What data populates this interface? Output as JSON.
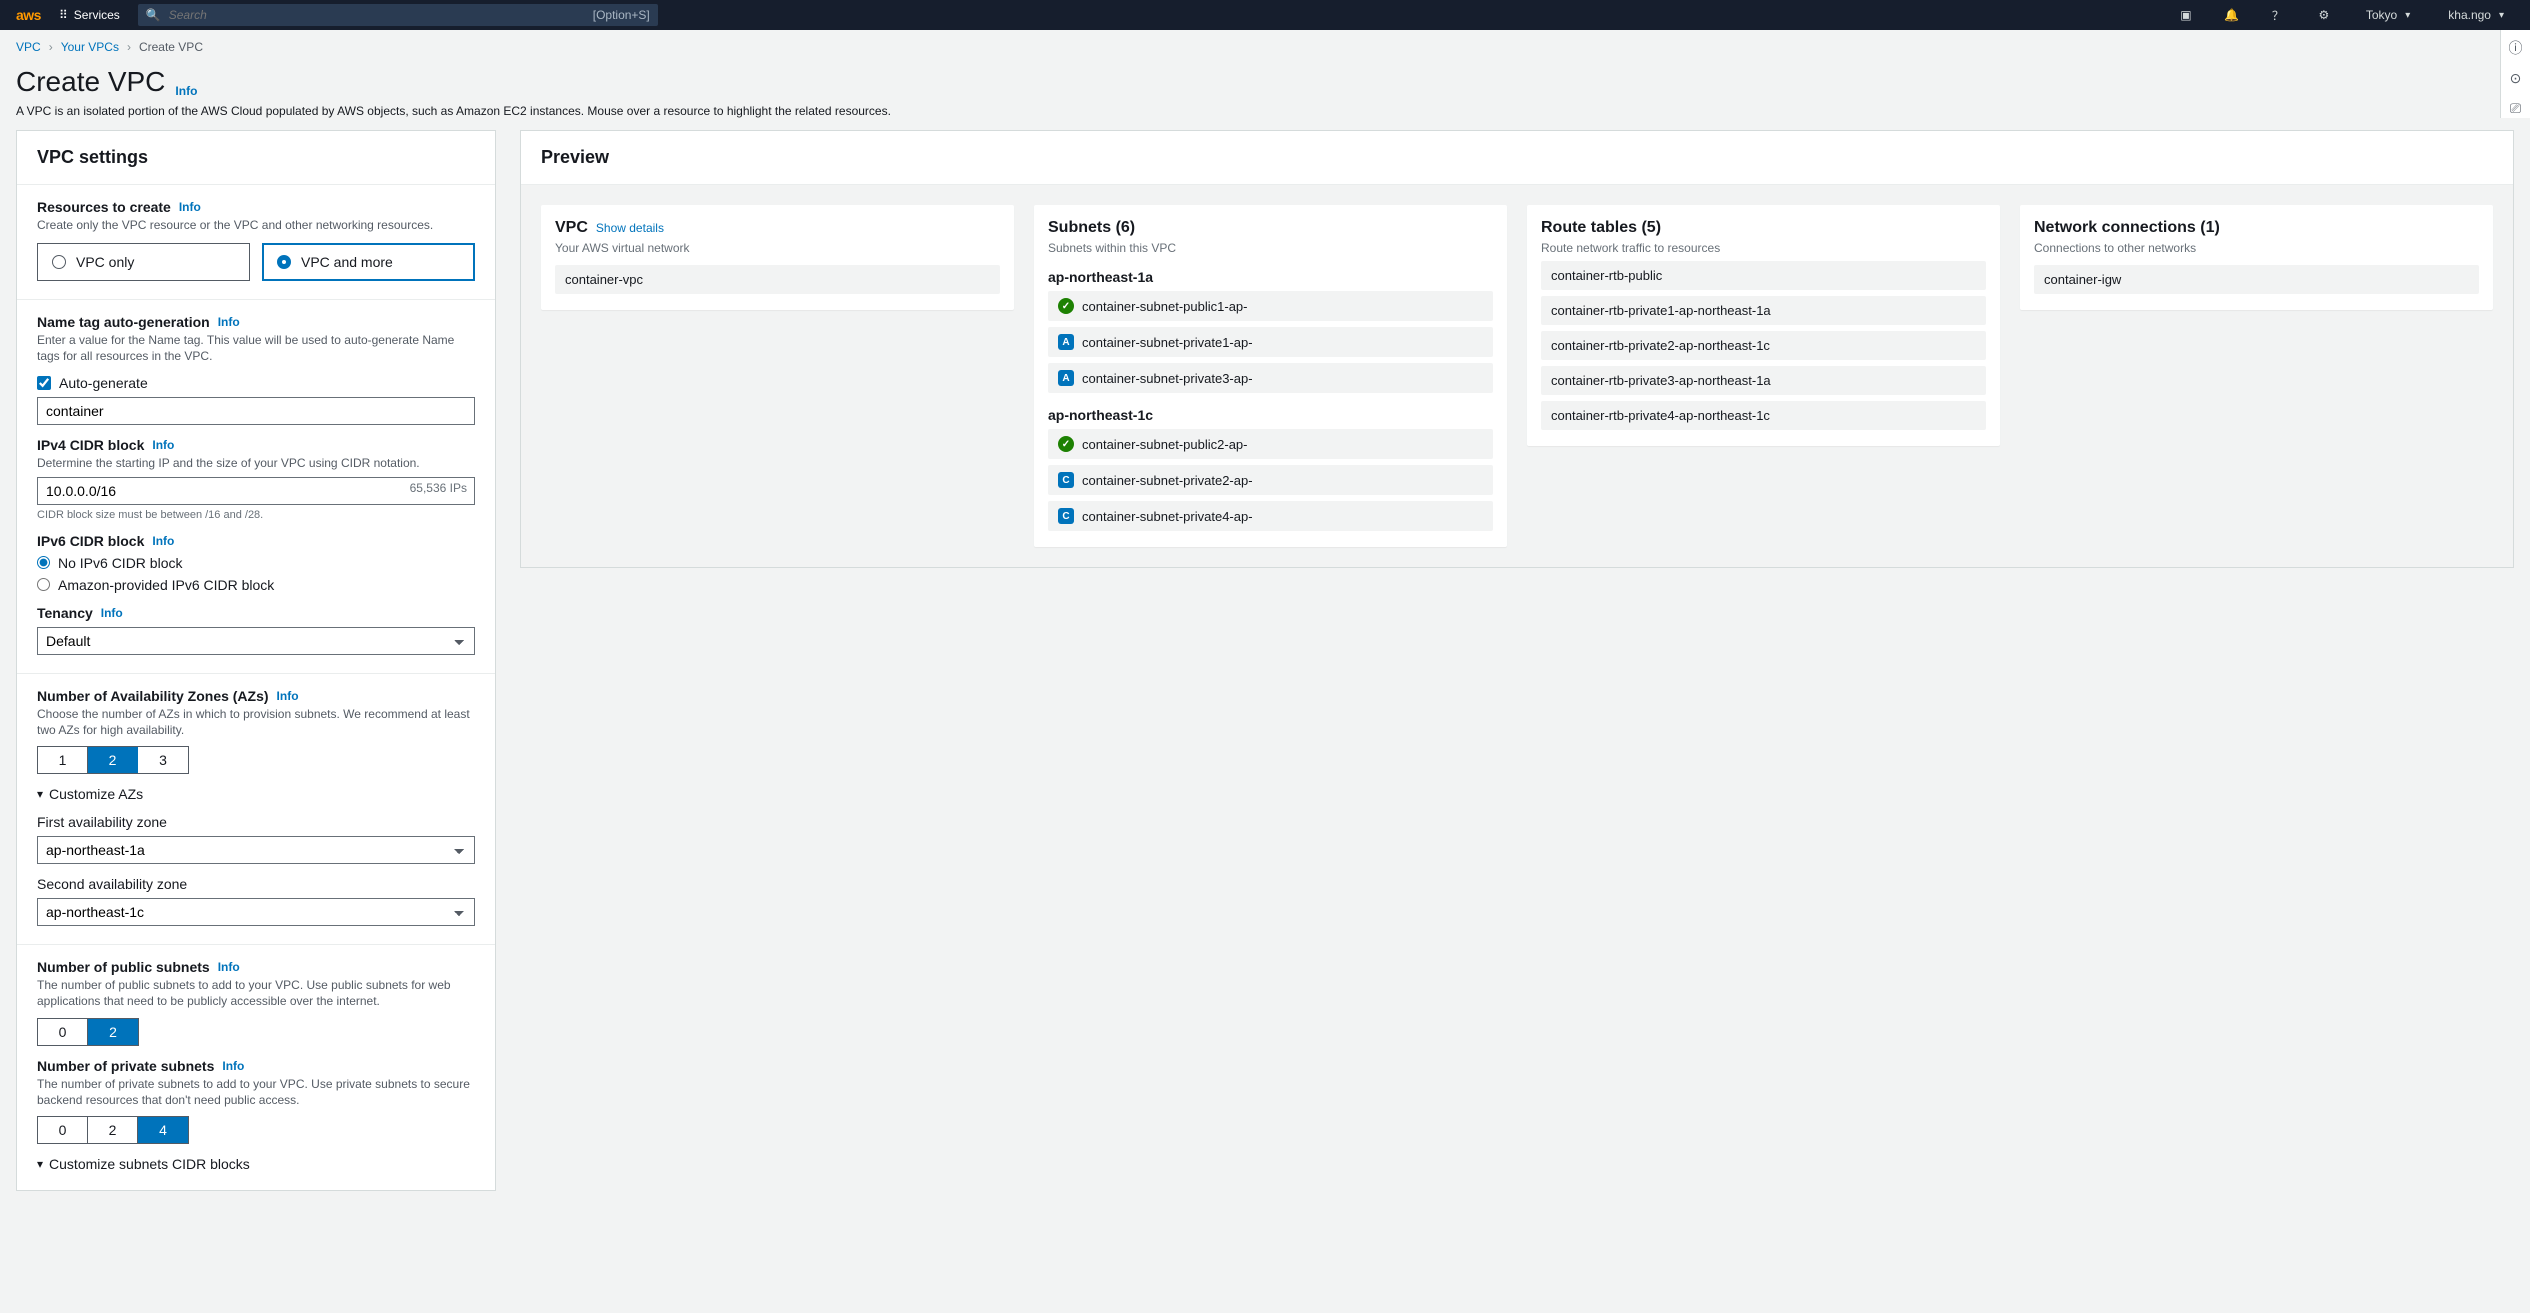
{
  "nav": {
    "logo": "aws",
    "services": "Services",
    "search_placeholder": "Search",
    "search_hint": "[Option+S]",
    "region": "Tokyo",
    "user": "kha.ngo"
  },
  "crumbs": {
    "vpc": "VPC",
    "your": "Your VPCs",
    "current": "Create VPC"
  },
  "header": {
    "title": "Create VPC",
    "info": "Info",
    "sub": "A VPC is an isolated portion of the AWS Cloud populated by AWS objects, such as Amazon EC2 instances. Mouse over a resource to highlight the related resources."
  },
  "settings": {
    "title": "VPC settings",
    "resources": {
      "label": "Resources to create",
      "desc": "Create only the VPC resource or the VPC and other networking resources.",
      "opt_only": "VPC only",
      "opt_more": "VPC and more"
    },
    "name": {
      "label": "Name tag auto-generation",
      "desc": "Enter a value for the Name tag. This value will be used to auto-generate Name tags for all resources in the VPC.",
      "auto": "Auto-generate",
      "value": "container"
    },
    "ipv4": {
      "label": "IPv4 CIDR block",
      "desc": "Determine the starting IP and the size of your VPC using CIDR notation.",
      "value": "10.0.0.0/16",
      "ips": "65,536 IPs",
      "constraint": "CIDR block size must be between /16 and /28."
    },
    "ipv6": {
      "label": "IPv6 CIDR block",
      "none": "No IPv6 CIDR block",
      "amz": "Amazon-provided IPv6 CIDR block"
    },
    "tenancy": {
      "label": "Tenancy",
      "value": "Default"
    },
    "azs": {
      "label": "Number of Availability Zones (AZs)",
      "desc": "Choose the number of AZs in which to provision subnets. We recommend at least two AZs for high availability.",
      "o1": "1",
      "o2": "2",
      "o3": "3",
      "customize": "Customize AZs",
      "first_label": "First availability zone",
      "first": "ap-northeast-1a",
      "second_label": "Second availability zone",
      "second": "ap-northeast-1c"
    },
    "pub": {
      "label": "Number of public subnets",
      "desc": "The number of public subnets to add to your VPC. Use public subnets for web applications that need to be publicly accessible over the internet.",
      "o0": "0",
      "o2": "2"
    },
    "priv": {
      "label": "Number of private subnets",
      "desc": "The number of private subnets to add to your VPC. Use private subnets to secure backend resources that don't need public access.",
      "o0": "0",
      "o2": "2",
      "o4": "4"
    },
    "custom_cidr": "Customize subnets CIDR blocks"
  },
  "preview": {
    "title": "Preview",
    "vpc": {
      "title": "VPC",
      "show": "Show details",
      "sub": "Your AWS virtual network",
      "name": "container-vpc"
    },
    "subnets": {
      "title": "Subnets (6)",
      "sub": "Subnets within this VPC",
      "az1": "ap-northeast-1a",
      "az1_items": [
        "container-subnet-public1-ap-",
        "container-subnet-private1-ap-",
        "container-subnet-private3-ap-"
      ],
      "az2": "ap-northeast-1c",
      "az2_items": [
        "container-subnet-public2-ap-",
        "container-subnet-private2-ap-",
        "container-subnet-private4-ap-"
      ]
    },
    "routes": {
      "title": "Route tables (5)",
      "sub": "Route network traffic to resources",
      "items": [
        "container-rtb-public",
        "container-rtb-private1-ap-northeast-1a",
        "container-rtb-private2-ap-northeast-1c",
        "container-rtb-private3-ap-northeast-1a",
        "container-rtb-private4-ap-northeast-1c"
      ]
    },
    "conn": {
      "title": "Network connections (1)",
      "sub": "Connections to other networks",
      "item": "container-igw"
    }
  }
}
